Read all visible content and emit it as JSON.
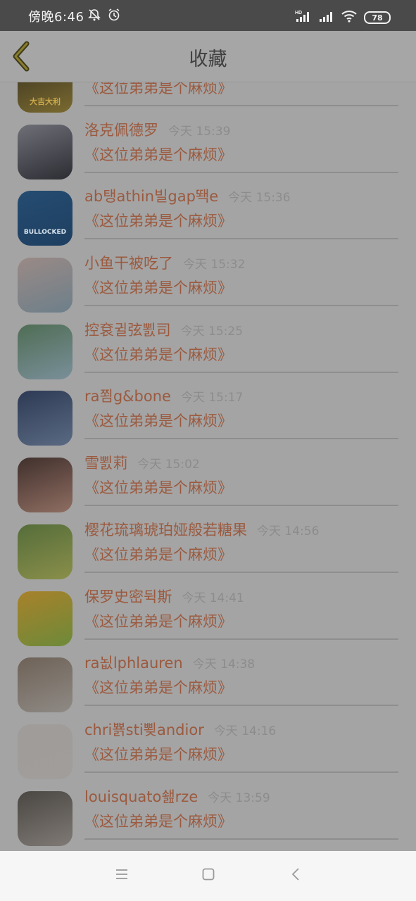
{
  "status_bar": {
    "time": "傍晚6:46",
    "battery": "78",
    "icons": [
      "notifications-off-icon",
      "alarm-icon",
      "signal-hd-icon",
      "signal-icon",
      "wifi-icon",
      "battery-icon"
    ]
  },
  "header": {
    "title": "收藏",
    "back_icon": "chevron-left-icon"
  },
  "items": [
    {
      "name": "",
      "time": "",
      "message": "《这位弟弟是个麻烦》",
      "avatar_colors": [
        "#3a3320",
        "#7a6a30"
      ],
      "avatar_text": "大吉大利"
    },
    {
      "name": "洛克佩德罗",
      "time": "今天 15:39",
      "message": "《这位弟弟是个麻烦》",
      "avatar_colors": [
        "#6f6f78",
        "#2c2c33"
      ],
      "avatar_text": ""
    },
    {
      "name": "ab탱athin빌gap뙉e",
      "time": "今天 15:36",
      "message": "《这位弟弟是个麻烦》",
      "avatar_colors": [
        "#254c72",
        "#1e3f60"
      ],
      "avatar_text": "BULLOCKED"
    },
    {
      "name": "小鱼干被吃了",
      "time": "今天 15:32",
      "message": "《这位弟弟是个麻烦》",
      "avatar_colors": [
        "#9a8a86",
        "#6d7f8a"
      ],
      "avatar_text": ""
    },
    {
      "name": "控袞귈弦뾠司",
      "time": "今天 15:25",
      "message": "《这位弟弟是个麻烦》",
      "avatar_colors": [
        "#4f6d54",
        "#7a8f9a"
      ],
      "avatar_text": ""
    },
    {
      "name": "ra쬠g&bone",
      "time": "今天 15:17",
      "message": "《这位弟弟是个麻烦》",
      "avatar_colors": [
        "#2e3a55",
        "#5a6a82"
      ],
      "avatar_text": ""
    },
    {
      "name": "雪뾠莉",
      "time": "今天 15:02",
      "message": "《这位弟弟是个麻烦》",
      "avatar_colors": [
        "#40302c",
        "#8f6e62"
      ],
      "avatar_text": ""
    },
    {
      "name": "樱花琉璃琥珀娅般若糖果",
      "time": "今天 14:56",
      "message": "《这位弟弟是个麻烦》",
      "avatar_colors": [
        "#556d3a",
        "#8a8f4a"
      ],
      "avatar_text": ""
    },
    {
      "name": "保罗史密뒥斯",
      "time": "今天 14:41",
      "message": "《这位弟弟是个麻烦》",
      "avatar_colors": [
        "#a8812a",
        "#6d8a3a"
      ],
      "avatar_text": ""
    },
    {
      "name": "ra뇞lphlauren",
      "time": "今天 14:38",
      "message": "《这位弟弟是个麻烦》",
      "avatar_colors": [
        "#6e6257",
        "#8f8a85"
      ],
      "avatar_text": ""
    },
    {
      "name": "chri뾹sti뾪andior",
      "time": "今天 14:16",
      "message": "《这位弟弟是个麻烦》",
      "avatar_colors": [
        "#9f9c9a",
        "#a09d9b"
      ],
      "avatar_text": ""
    },
    {
      "name": "louisquato쇒rze",
      "time": "今天 13:59",
      "message": "《这位弟弟是个麻烦》",
      "avatar_colors": [
        "#4a4642",
        "#7f7a76"
      ],
      "avatar_text": ""
    }
  ],
  "nav_bar": {
    "icons": [
      "menu-icon",
      "home-icon",
      "back-icon"
    ]
  }
}
